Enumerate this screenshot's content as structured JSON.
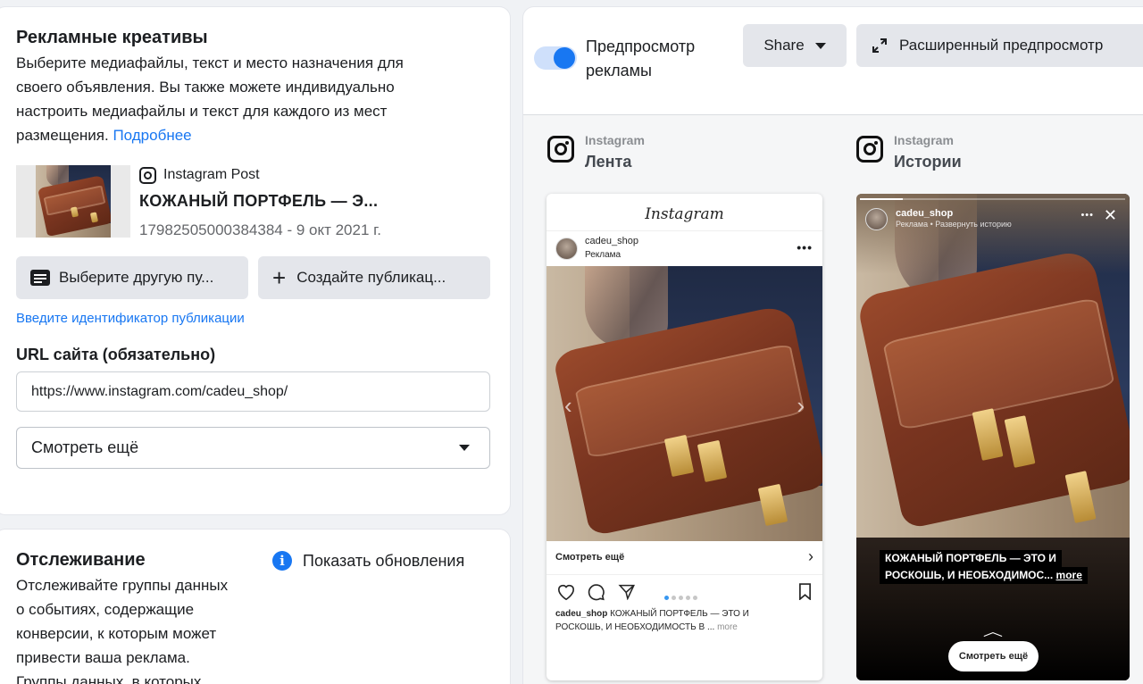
{
  "creatives": {
    "title": "Рекламные креативы",
    "description_line1": "Выберите медиафайлы, текст и место назначения для",
    "description_line2": "своего объявления. Вы также можете индивидуально",
    "description_line3": "настроить медиафайлы и текст для каждого из мест",
    "description_line4": "размещения.",
    "learn_more": "Подробнее",
    "post": {
      "platform_label": "Instagram Post",
      "title": "КОЖАНЫЙ ПОРТФЕЛЬ — Э...",
      "meta": "17982505000384384 - 9 окт 2021 г."
    },
    "choose_other_button": "Выберите другую пу...",
    "create_post_button": "Создайте публикац...",
    "enter_id_link": "Введите идентификатор публикации",
    "url_label": "URL сайта (обязательно)",
    "url_value": "https://www.instagram.com/cadeu_shop/",
    "cta_select": "Смотреть ещё"
  },
  "tracking": {
    "title": "Отслеживание",
    "show_updates": "Показать обновления",
    "line1": "Отслеживайте группы данных",
    "line2": "о событиях, содержащие",
    "line3": "конверсии, к которым может",
    "line4": "привести ваша реклама.",
    "line5": "Группы данных, в которых"
  },
  "preview": {
    "toggle_label_line1": "Предпросмотр",
    "toggle_label_line2": "рекламы",
    "toggle_on": true,
    "share_button": "Share",
    "advanced_button": "Расширенный предпросмотр",
    "placements": [
      {
        "platform": "Instagram",
        "name": "Лента"
      },
      {
        "platform": "Instagram",
        "name": "Истории"
      }
    ]
  },
  "feed_mock": {
    "logo": "Instagram",
    "username": "cadeu_shop",
    "sponsored": "Реклама",
    "cta": "Смотреть ещё",
    "caption_user": "cadeu_shop",
    "caption_line1": "КОЖАНЫЙ ПОРТФЕЛЬ — ЭТО И",
    "caption_line2": "РОСКОШЬ, И НЕОБХОДИМОСТЬ В ...",
    "caption_more": "more"
  },
  "story_mock": {
    "username": "cadeu_shop",
    "subline": "Реклама • Развернуть историю",
    "caption_line1": "КОЖАНЫЙ ПОРТФЕЛЬ — ЭТО И",
    "caption_line2": "РОСКОШЬ, И НЕОБХОДИМОС...",
    "caption_more": "more",
    "cta": "Смотреть ещё"
  },
  "colors": {
    "accent": "#1877f2",
    "page_bg": "#f0f2f5",
    "button_bg": "#e4e6eb"
  }
}
